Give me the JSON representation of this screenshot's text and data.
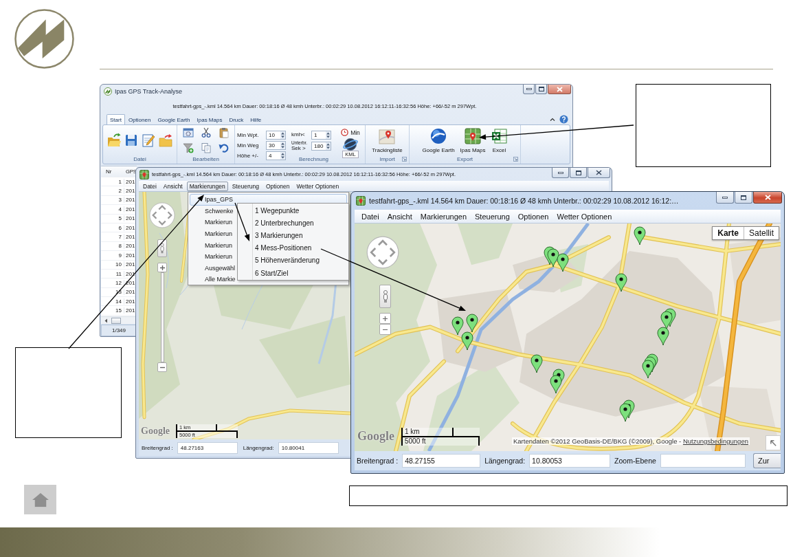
{
  "main_window": {
    "title": "Ipas GPS Track-Analyse",
    "info": "testfahrt-gps_-.kml 14.564 km Dauer: 00:18:16 Ø 48 kmh Unterbr.: 00:02:29 10.08.2012 16:12:11-16:32:56 Höhe: +66/-52 m 297Wpt.",
    "tabs": [
      {
        "label": "Start",
        "selected": true
      },
      {
        "label": "Optionen",
        "selected": false
      },
      {
        "label": "Google Earth",
        "selected": false
      },
      {
        "label": "Ipas Maps",
        "selected": false
      },
      {
        "label": "Druck",
        "selected": false
      },
      {
        "label": "Hilfe",
        "selected": false
      }
    ],
    "ribbon": {
      "file_group": "Datei",
      "edit_group": "Bearbeiten",
      "calc_group": {
        "label": "Berechnung",
        "spinners": [
          {
            "label": "Min Wpt.",
            "value": "10"
          },
          {
            "label": "Min Weg",
            "value": "30"
          },
          {
            "label": "Höhe +/-",
            "value": "4"
          }
        ],
        "rate_spinners": [
          {
            "label": "kmh<",
            "value": "1"
          },
          {
            "label": "Unterbr.",
            "sublabel": "Sek >",
            "value": "180"
          }
        ],
        "timer_button": "Min",
        "kml_button": "KML"
      },
      "import_group": {
        "label": "Import",
        "button": "Trackingliste"
      },
      "export_group": {
        "label": "Export",
        "buttons": [
          "Google Earth",
          "Ipas Maps",
          "Excel"
        ]
      }
    },
    "table": {
      "columns": [
        "Nr",
        "GPS"
      ],
      "rows": [
        [
          "1",
          "201"
        ],
        [
          "2",
          "201"
        ],
        [
          "3",
          "201"
        ],
        [
          "4",
          "201"
        ],
        [
          "5",
          "201"
        ],
        [
          "6",
          "201"
        ],
        [
          "7",
          "201"
        ],
        [
          "8",
          "201"
        ],
        [
          "9",
          "201"
        ],
        [
          "10",
          "201"
        ],
        [
          "11",
          "201"
        ],
        [
          "12",
          "201"
        ],
        [
          "13",
          "201"
        ],
        [
          "14",
          "201"
        ],
        [
          "15",
          "201"
        ]
      ]
    },
    "status": "1/349"
  },
  "back_map_window": {
    "title": "testfahrt-gps_-.kml 14.564 km Dauer: 00:18:16 Ø 48 kmh Unterbr.: 00:02:29 10.08.2012 16:12:11-16:32:56 Höhe: +66/-52 m 297Wpt.",
    "menu": [
      {
        "label": "Datei",
        "selected": false
      },
      {
        "label": "Ansicht",
        "selected": false
      },
      {
        "label": "Markierungen",
        "selected": true
      },
      {
        "label": "Steuerung",
        "selected": false
      },
      {
        "label": "Optionen",
        "selected": false
      },
      {
        "label": "Wetter Optionen",
        "selected": false
      }
    ],
    "dropdown": [
      {
        "label": "Ipas_GPS",
        "selected": true
      },
      {
        "label": "Schwenke",
        "selected": false
      },
      {
        "label": "Markierun",
        "selected": false
      },
      {
        "label": "Markierun",
        "selected": false
      },
      {
        "label": "Markierun",
        "selected": false
      },
      {
        "label": "Markierun",
        "selected": false
      },
      {
        "label": "Ausgewähl",
        "selected": false
      },
      {
        "label": "Alle Markie",
        "selected": false
      }
    ],
    "submenu": [
      {
        "label": "1 Wegepunkte",
        "selected": false
      },
      {
        "label": "2 Unterbrechungen",
        "selected": false
      },
      {
        "label": "3 Markierungen",
        "selected": false
      },
      {
        "label": "4 Mess-Positionen",
        "selected": false
      },
      {
        "label": "5 Höhenveränderung",
        "selected": false
      },
      {
        "label": "6 Start/Ziel",
        "selected": false
      }
    ],
    "map": {
      "logo": "Google",
      "scale_km": "1 km",
      "scale_ft": "5000 ft"
    },
    "fields": [
      {
        "label": "Breitengrad :",
        "value": "48.27163"
      },
      {
        "label": "Längengrad:",
        "value": "10.80041"
      }
    ]
  },
  "front_map_window": {
    "title": "testfahrt-gps_-.kml 14.564 km Dauer: 00:18:16 Ø 48 kmh Unterbr.: 00:02:29 10.08.2012 16:12:…",
    "menu": [
      {
        "label": "Datei",
        "selected": false
      },
      {
        "label": "Ansicht",
        "selected": false
      },
      {
        "label": "Markierungen",
        "selected": false
      },
      {
        "label": "Steuerung",
        "selected": false
      },
      {
        "label": "Optionen",
        "selected": false
      },
      {
        "label": "Wetter Optionen",
        "selected": false
      }
    ],
    "map": {
      "map_types": [
        {
          "label": "Karte",
          "selected": true
        },
        {
          "label": "Satellit",
          "selected": false
        }
      ],
      "logo": "Google",
      "scale_km": "1 km",
      "scale_ft": "5000 ft",
      "attribution": "Kartendaten ©2012 GeoBasis-DE/BKG (©2009), Google -",
      "terms_link": "Nutzungsbedingungen"
    },
    "fields": [
      {
        "label": "Breitengrad :",
        "value": "48.27155"
      },
      {
        "label": "Längengrad:",
        "value": "10.80053"
      },
      {
        "label": "Zoom-Ebene"
      }
    ],
    "button": "Zur"
  }
}
